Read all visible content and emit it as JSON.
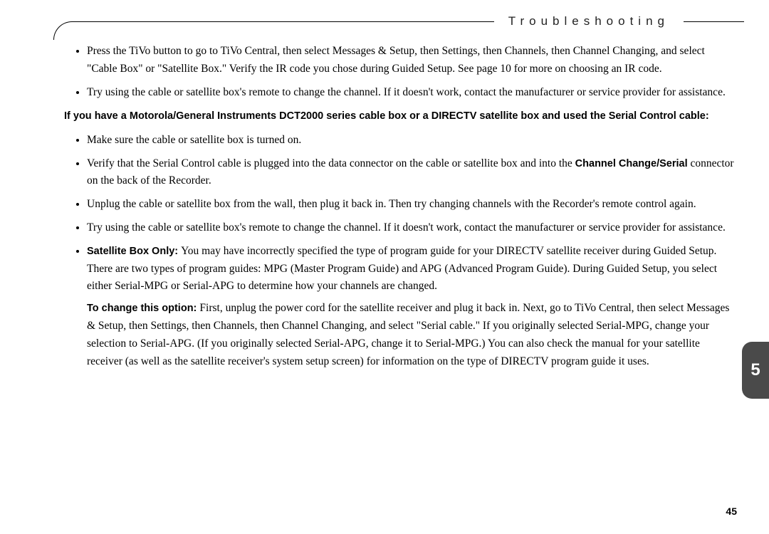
{
  "header": {
    "title": "Troubleshooting"
  },
  "list1": {
    "items": [
      "Press the TiVo button to go to TiVo Central, then select Messages & Setup, then Settings, then Channels, then Channel Changing, and select \"Cable Box\" or \"Satellite Box.\" Verify the IR code you chose during Guided Setup. See page 10 for more on choosing an IR code.",
      "Try using the cable or satellite box's remote to change the channel. If it doesn't work, contact the manufacturer or service provider for assistance."
    ]
  },
  "intro": "If you have a Motorola/General Instruments DCT2000 series cable box or a DIRECTV satellite box and used the Serial Control cable:",
  "list2": {
    "i0": "Make sure the cable or satellite box is turned on.",
    "i1a": "Verify that the Serial Control cable is plugged into the data connector on the cable or satellite box and into the ",
    "i1b": "Channel Change/Serial",
    "i1c": " connector on the back of the Recorder.",
    "i2": "Unplug the cable or satellite box from the wall, then plug it back in. Then try changing channels with the Recorder's remote control again.",
    "i3": "Try using the cable or satellite box's remote to change the channel. If it doesn't work, contact the manufacturer or service provider for assistance.",
    "i4a": "Satellite Box Only: ",
    "i4b": "You may have incorrectly specified the type of program guide for your DIRECTV satellite receiver during Guided Setup. There are two types of program guides: MPG (Master Program Guide) and APG (Advanced Program Guide). During Guided Setup, you select either Serial-MPG or Serial-APG to determine how your channels are changed.",
    "i4c": "To change this option: ",
    "i4d": "First, unplug the power cord for the satellite receiver and plug it back in. Next, go to TiVo Central, then select Messages & Setup, then Settings, then Channels, then Channel Changing, and select \"Serial cable.\" If you originally selected Serial-MPG, change your selection to Serial-APG. (If you originally selected Serial-APG, change it to Serial-MPG.) You can also check the manual for your satellite receiver (as well as the satellite receiver's system setup screen) for information on the type of DIRECTV program guide it uses."
  },
  "tab": "5",
  "pageNumber": "45"
}
